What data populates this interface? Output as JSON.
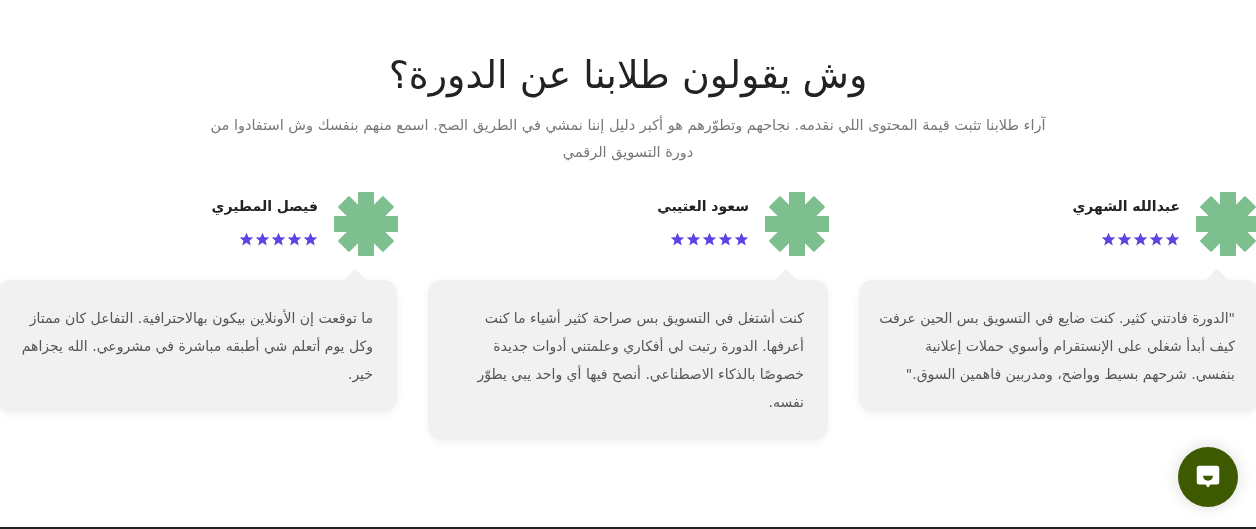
{
  "heading": "وش يقولون طلابنا عن الدورة؟",
  "intro": "آراء طلابنا تثبت قيمة المحتوى اللي نقدمه. نجاحهم وتطوّرهم هو أكبر دليل إننا نمشي في الطريق الصح. اسمع منهم بنفسك وش استفادوا من دورة التسويق الرقمي",
  "testimonials": [
    {
      "name": "عبدالله الشهري",
      "stars": 5,
      "quote": "\"الدورة فادتني كثير. كنت ضايع في التسويق بس الحين عرفت كيف أبدأ شغلي على الإنستقرام وأسوي حملات إعلانية بنفسي. شرحهم بسيط وواضح، ومدربين فاهمين السوق.\""
    },
    {
      "name": "سعود العتيبي",
      "stars": 5,
      "quote": "كنت أشتغل في التسويق بس صراحة كثير أشياء ما كنت أعرفها. الدورة رتبت لي أفكاري وعلمتني أدوات جديدة خصوصًا بالذكاء الاصطناعي. أنصح فيها أي واحد يبي يطوّر نفسه."
    },
    {
      "name": "فيصل المطيري",
      "stars": 5,
      "quote": "ما توقعت إن الأونلاين بيكون بهالاحترافية. التفاعل كان ممتاز وكل يوم أتعلم شي أطبقه مباشرة في مشروعي. الله يجزاهم خير."
    }
  ]
}
